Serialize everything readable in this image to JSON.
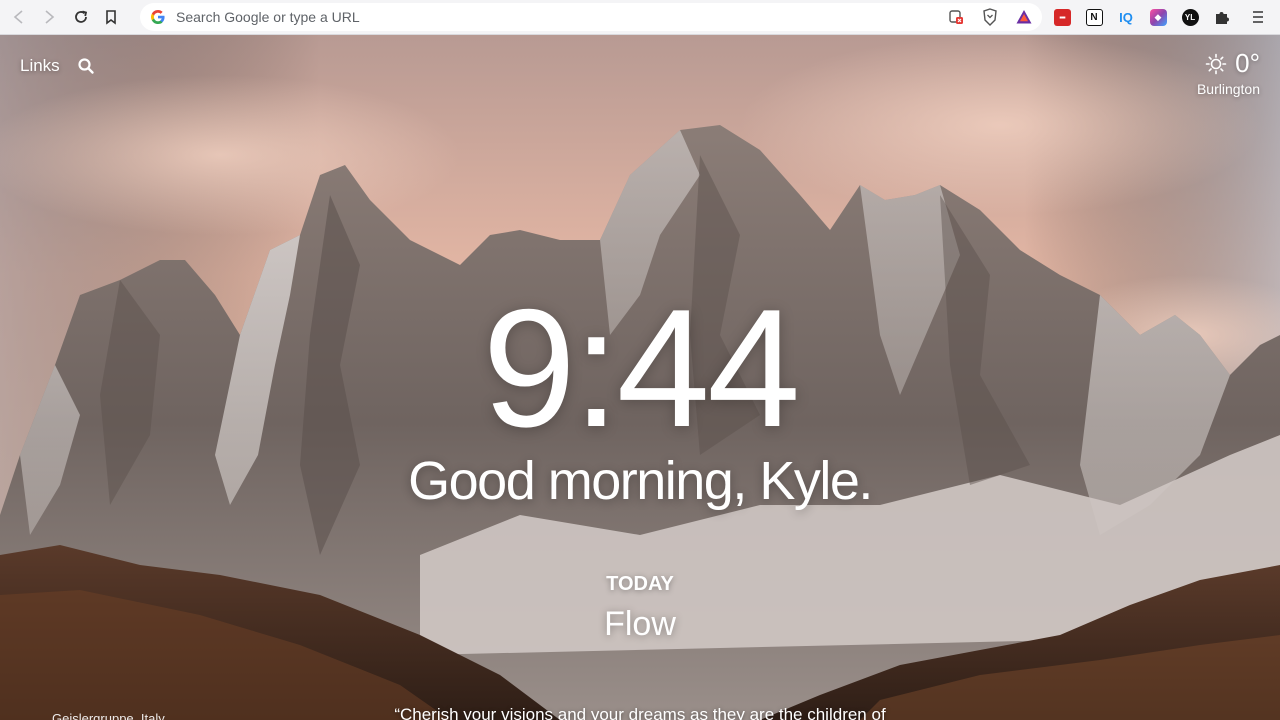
{
  "browser": {
    "omnibox_placeholder": "Search Google or type a URL",
    "extensions": [
      {
        "name": "extension-red-icon",
        "label": "▪▪▪",
        "color": "#d62828"
      },
      {
        "name": "notion-icon",
        "label": "N",
        "color": "#111111"
      },
      {
        "name": "iq-icon",
        "label": "IQ",
        "color": "#1f8ef1"
      },
      {
        "name": "extension-gradient-icon",
        "label": "◆",
        "color": "#8e44ad"
      },
      {
        "name": "extension-ym-icon",
        "label": "YL",
        "color": "#111111"
      }
    ]
  },
  "topbar": {
    "links_label": "Links"
  },
  "weather": {
    "temperature": "0°",
    "location": "Burlington",
    "icon": "sun-icon"
  },
  "clock": {
    "time": "9:44"
  },
  "greeting": {
    "text": "Good morning, Kyle."
  },
  "focus": {
    "label": "TODAY",
    "task": "Flow"
  },
  "footer": {
    "photo_credit": "Geislergruppe, Italy",
    "quote": "“Cherish your visions and your dreams as they are the children of"
  },
  "colors": {
    "sky_top": "#c9a49a",
    "sky_pink": "#e8b7a3",
    "rock": "#7a6c66",
    "snow": "#dcd8d6",
    "forest": "#4a2f22"
  }
}
